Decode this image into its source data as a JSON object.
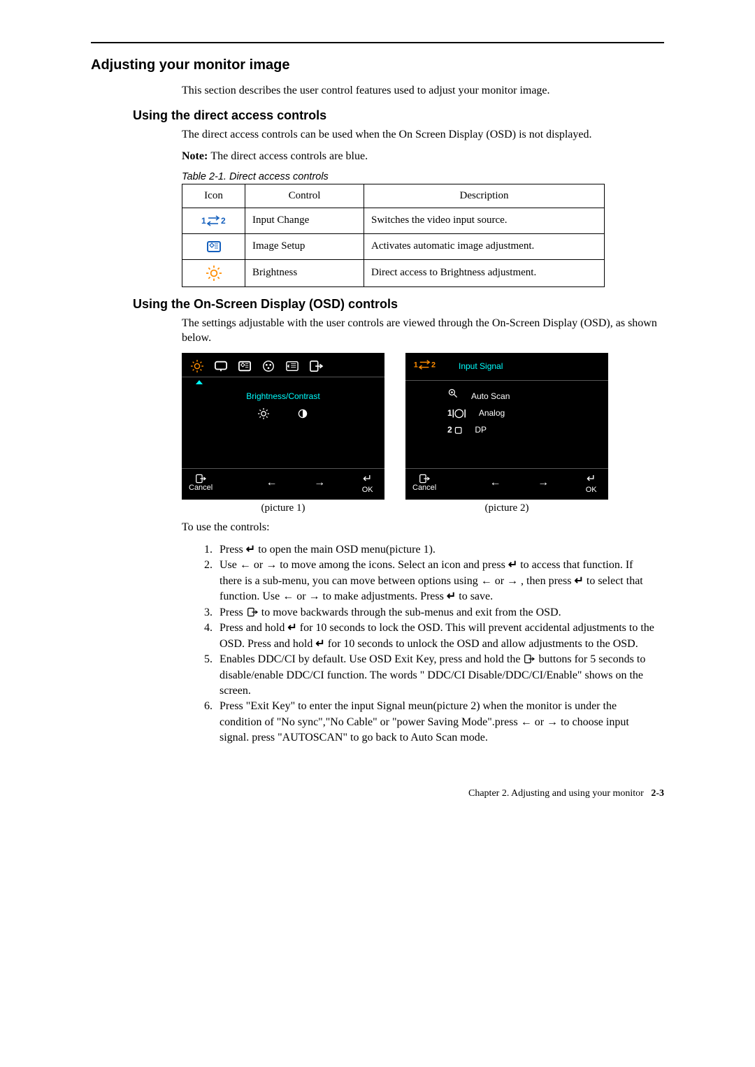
{
  "headings": {
    "h2": "Adjusting your monitor image",
    "h3a": "Using the direct access controls",
    "h3b": "Using the On-Screen Display (OSD) controls"
  },
  "paras": {
    "intro": "This section describes the user control features used to adjust your monitor image.",
    "direct1": "The direct access controls can be used when the On Screen Display (OSD) is not displayed.",
    "note_label": "Note: ",
    "note_text": "The direct access controls are blue.",
    "osd1": "The settings adjustable with the user controls are viewed through the On-Screen Display (OSD), as shown below.",
    "touse": "To use the controls:"
  },
  "table": {
    "caption": "Table 2-1. Direct access controls",
    "headers": [
      "Icon",
      "Control",
      "Description"
    ],
    "rows": [
      {
        "icon_name": "input-change-icon",
        "control": "Input Change",
        "desc": "Switches the video input source."
      },
      {
        "icon_name": "image-setup-icon",
        "control": "Image Setup",
        "desc": "Activates automatic image adjustment."
      },
      {
        "icon_name": "brightness-icon",
        "control": "Brightness",
        "desc": "Direct access to Brightness adjustment."
      }
    ]
  },
  "osd_panel1": {
    "title": "Brightness/Contrast",
    "bottom": {
      "cancel": "Cancel",
      "ok": "OK"
    }
  },
  "osd_panel2": {
    "title": "Input Signal",
    "items": [
      "Auto Scan",
      "Analog",
      "DP"
    ],
    "bottom": {
      "cancel": "Cancel",
      "ok": "OK"
    }
  },
  "pic_labels": {
    "p1": "(picture 1)",
    "p2": "(picture 2)"
  },
  "steps": {
    "s1a": "Press ",
    "s1b": " to open the main OSD menu(picture 1).",
    "s2a": "Use ",
    "s2b": " or ",
    "s2c": " to move among the icons. Select an icon and press ",
    "s2d": " to access that function. If there is a sub-menu, you can move between options using ",
    "s2e": " or ",
    "s2f": " , then press ",
    "s2g": " to select that function. Use ",
    "s2h": " or ",
    "s2i": " to make adjustments. Press ",
    "s2j": " to save.",
    "s3a": "Press ",
    "s3b": " to move backwards through the sub-menus and exit from the OSD.",
    "s4a": "Press and hold ",
    "s4b": " for 10 seconds to lock the OSD. This will prevent accidental adjustments to the OSD. Press and hold ",
    "s4c": " for 10 seconds to unlock the OSD and allow adjustments to the OSD.",
    "s5a": "Enables DDC/CI by default. Use OSD Exit Key, press and hold the ",
    "s5b": " buttons for 5 seconds to disable/enable DDC/CI function. The words \" DDC/CI Disable/DDC/CI/Enable\" shows on the screen.",
    "s6a": "Press \"Exit Key\" to enter the input Signal meun(picture 2) when the monitor is under the condition of \"No sync\",\"No Cable\" or \"power Saving Mode\".press ",
    "s6b": " or ",
    "s6c": " to choose input signal. press \"AUTOSCAN\" to go back to Auto Scan mode."
  },
  "footer": {
    "chapter": "Chapter 2. Adjusting and using your monitor",
    "page": "2-3"
  },
  "icons": {
    "enter": "↵",
    "left": "←",
    "right": "→",
    "exit_box": "exit-icon"
  },
  "colors": {
    "orange": "#ff8c00",
    "blue": "#1560bd",
    "cyan": "#0ff"
  }
}
